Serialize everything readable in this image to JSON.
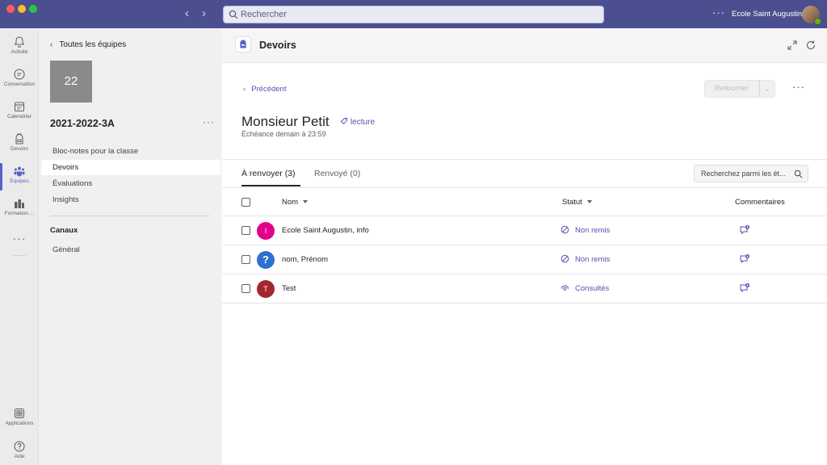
{
  "titlebar": {
    "search_placeholder": "Rechercher",
    "more": "···",
    "organization": "Ecole Saint Augustin"
  },
  "rail": {
    "items": [
      {
        "label": "Activité",
        "icon": "bell-icon"
      },
      {
        "label": "Conversation",
        "icon": "chat-icon"
      },
      {
        "label": "Calendrier",
        "icon": "calendar-icon"
      },
      {
        "label": "Devoirs",
        "icon": "backpack-icon"
      },
      {
        "label": "Équipes",
        "icon": "teams-icon",
        "active": true
      },
      {
        "label": "Formation ...",
        "icon": "learning-icon"
      }
    ],
    "more": "···",
    "bottom": [
      {
        "label": "Applications",
        "icon": "apps-icon"
      },
      {
        "label": "Aide",
        "icon": "help-icon"
      }
    ]
  },
  "panel": {
    "back_label": "Toutes les équipes",
    "team_tile": "22",
    "team_name": "2021-2022-3A",
    "more": "···",
    "items": [
      {
        "label": "Bloc-notes pour la classe"
      },
      {
        "label": "Devoirs",
        "active": true
      },
      {
        "label": "Évaluations"
      },
      {
        "label": "Insights"
      }
    ],
    "channels_title": "Canaux",
    "channels": [
      {
        "label": "Général"
      }
    ]
  },
  "header": {
    "app_title": "Devoirs"
  },
  "assignment": {
    "back_label": "Précédent",
    "return_button": "Retourner",
    "more": "···",
    "student_name": "Monsieur Petit",
    "tag": "lecture",
    "due": "Échéance demain à 23:59"
  },
  "tabs": [
    {
      "label": "À renvoyer (3)",
      "active": true
    },
    {
      "label": "Renvoyé (0)",
      "active": false
    }
  ],
  "table_search_placeholder": "Recherchez parmi les ét...",
  "table": {
    "columns": {
      "name": "Nom",
      "status": "Statut",
      "comments": "Commentaires"
    },
    "rows": [
      {
        "initial": "I",
        "avatar_color": "#e3008c",
        "name": "Ecole Saint Augustin, info",
        "status": "Non remis",
        "status_icon": "blocked-icon"
      },
      {
        "initial": "?",
        "avatar_color": "#2f6fcf",
        "name": "nom, Prénom",
        "status": "Non remis",
        "status_icon": "blocked-icon"
      },
      {
        "initial": "T",
        "avatar_color": "#a4262c",
        "name": "Test",
        "status": "Consultés",
        "status_icon": "eye-icon"
      }
    ]
  },
  "colors": {
    "titlebar": "#4b4f8f",
    "accent": "#5b5fc7",
    "link": "#4f52b2"
  }
}
